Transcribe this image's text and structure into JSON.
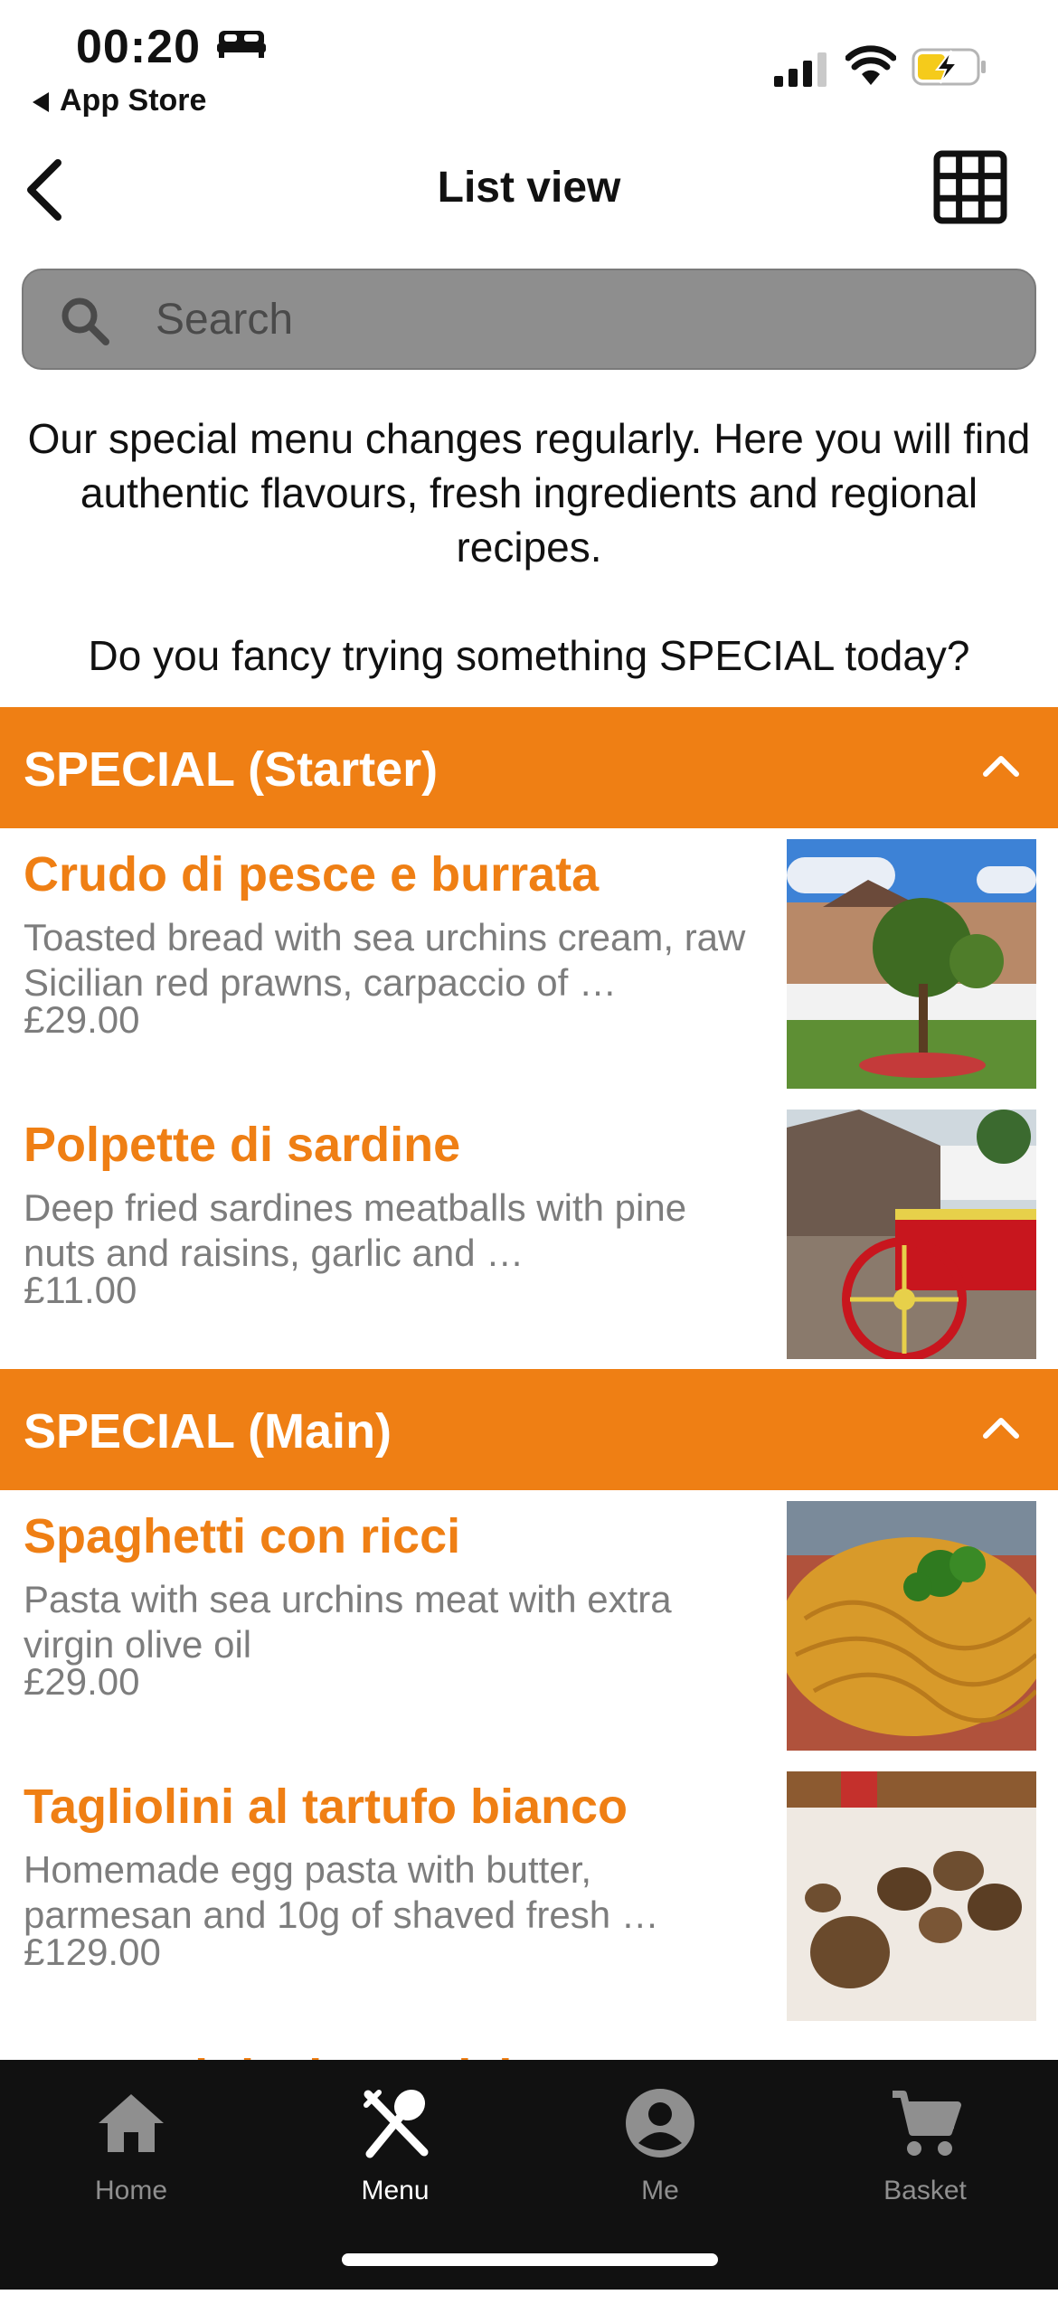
{
  "status_bar": {
    "time": "00:20",
    "back_label": "App Store",
    "battery_color": "#f5cb1b"
  },
  "nav": {
    "title": "List view"
  },
  "search": {
    "placeholder": "Search",
    "value": ""
  },
  "intro": {
    "text": "Our special menu changes regularly. Here you will find authentic flavours, fresh ingredients and regional recipes.",
    "question": "Do you fancy trying something SPECIAL today?"
  },
  "colors": {
    "accent": "#ef7f14",
    "tabbar": "#111111"
  },
  "sections": [
    {
      "title": "SPECIAL (Starter)",
      "items": [
        {
          "name": "Crudo di pesce e burrata",
          "desc": "Toasted bread with sea urchins cream, raw Sicilian red prawns, carpaccio of …",
          "price": "£29.00"
        },
        {
          "name": "Polpette di sardine",
          "desc": "Deep fried sardines meatballs with pine nuts and raisins, garlic and …",
          "price": "£11.00"
        }
      ]
    },
    {
      "title": "SPECIAL (Main)",
      "items": [
        {
          "name": "Spaghetti con ricci",
          "desc": " Pasta with sea urchins meat with extra virgin olive oil",
          "price": "£29.00"
        },
        {
          "name": "Tagliolini al tartufo bianco",
          "desc": "Homemade egg pasta with butter, parmesan and 10g of shaved fresh …",
          "price": "£129.00"
        },
        {
          "name": "Pasta ai ricci e caviale",
          "desc": "",
          "price": ""
        }
      ]
    }
  ],
  "tabs": [
    {
      "label": "Home",
      "icon": "home-icon"
    },
    {
      "label": "Menu",
      "icon": "menu-utensils-icon"
    },
    {
      "label": "Me",
      "icon": "account-icon"
    },
    {
      "label": "Basket",
      "icon": "cart-icon"
    }
  ],
  "active_tab": "Menu"
}
